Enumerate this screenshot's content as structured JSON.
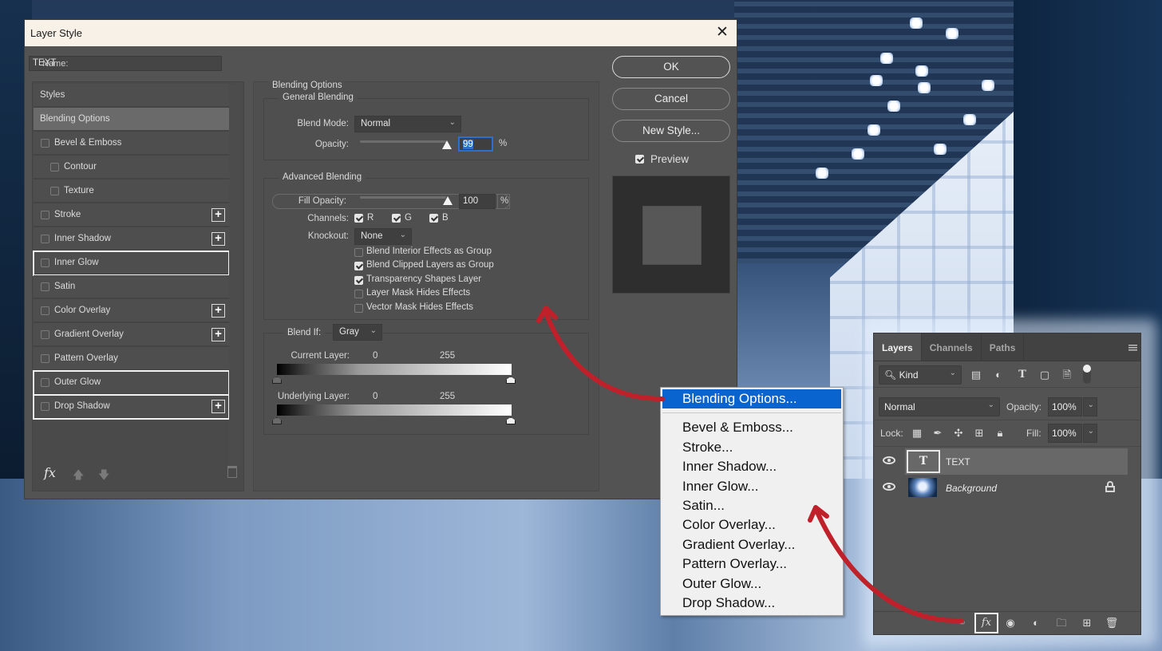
{
  "dialog": {
    "title": "Layer Style",
    "close_glyph": "✕",
    "name_label": "Name:",
    "name_value": "TEXT",
    "styles_header": "Styles",
    "styles": [
      {
        "label": "Blending Options",
        "active": true,
        "checkbox": false,
        "plus": false,
        "highlighted": false
      },
      {
        "label": "Bevel & Emboss",
        "checked": false,
        "plus": false,
        "highlighted": false
      },
      {
        "label": "Contour",
        "checked": false,
        "sub": true,
        "plus": false,
        "highlighted": false
      },
      {
        "label": "Texture",
        "checked": false,
        "sub": true,
        "plus": false,
        "highlighted": false
      },
      {
        "label": "Stroke",
        "checked": false,
        "plus": true,
        "highlighted": false
      },
      {
        "label": "Inner Shadow",
        "checked": false,
        "plus": true,
        "highlighted": false
      },
      {
        "label": "Inner Glow",
        "checked": false,
        "plus": false,
        "highlighted": true
      },
      {
        "label": "Satin",
        "checked": false,
        "plus": false,
        "highlighted": false
      },
      {
        "label": "Color Overlay",
        "checked": false,
        "plus": true,
        "highlighted": false
      },
      {
        "label": "Gradient Overlay",
        "checked": false,
        "plus": true,
        "highlighted": false
      },
      {
        "label": "Pattern Overlay",
        "checked": false,
        "plus": false,
        "highlighted": false
      },
      {
        "label": "Outer Glow",
        "checked": false,
        "plus": false,
        "highlighted": true
      },
      {
        "label": "Drop Shadow",
        "checked": false,
        "plus": true,
        "highlighted": true
      }
    ],
    "footer": {
      "fx_label": "fx",
      "move_up_glyph": "🡅",
      "move_down_glyph": "🡇"
    },
    "blending_options": {
      "title": "Blending Options",
      "general": {
        "title": "General Blending",
        "blend_mode_label": "Blend Mode:",
        "blend_mode_value": "Normal",
        "opacity_label": "Opacity:",
        "opacity_value": "99",
        "opacity_unit": "%"
      },
      "advanced": {
        "title": "Advanced Blending",
        "fill_opacity_label": "Fill Opacity:",
        "fill_opacity_value": "100",
        "fill_opacity_unit": "%",
        "channels_label": "Channels:",
        "channels": [
          {
            "label": "R",
            "checked": true
          },
          {
            "label": "G",
            "checked": true
          },
          {
            "label": "B",
            "checked": true
          }
        ],
        "knockout_label": "Knockout:",
        "knockout_value": "None",
        "options": [
          {
            "label": "Blend Interior Effects as Group",
            "checked": false
          },
          {
            "label": "Blend Clipped Layers as Group",
            "checked": true
          },
          {
            "label": "Transparency Shapes Layer",
            "checked": true
          },
          {
            "label": "Layer Mask Hides Effects",
            "checked": false
          },
          {
            "label": "Vector Mask Hides Effects",
            "checked": false
          }
        ]
      },
      "blend_if": {
        "label": "Blend If:",
        "value": "Gray",
        "current_layer_label": "Current Layer:",
        "current_low": "0",
        "current_high": "255",
        "underlying_layer_label": "Underlying Layer:",
        "underlying_low": "0",
        "underlying_high": "255"
      }
    },
    "buttons": {
      "ok": "OK",
      "cancel": "Cancel",
      "new_style": "New Style..."
    },
    "preview": {
      "label": "Preview",
      "checked": true
    }
  },
  "context_menu": {
    "items": [
      {
        "label": "Blending Options...",
        "selected": true
      },
      {
        "separator": true
      },
      {
        "label": "Bevel & Emboss..."
      },
      {
        "label": "Stroke..."
      },
      {
        "label": "Inner Shadow..."
      },
      {
        "label": "Inner Glow..."
      },
      {
        "label": "Satin..."
      },
      {
        "label": "Color Overlay..."
      },
      {
        "label": "Gradient Overlay..."
      },
      {
        "label": "Pattern Overlay..."
      },
      {
        "label": "Outer Glow..."
      },
      {
        "label": "Drop Shadow..."
      }
    ]
  },
  "layers_panel": {
    "tabs": [
      {
        "label": "Layers",
        "active": true
      },
      {
        "label": "Channels",
        "active": false
      },
      {
        "label": "Paths",
        "active": false
      }
    ],
    "filter_kind": "Kind",
    "blend_mode": "Normal",
    "opacity_label": "Opacity:",
    "opacity_value": "100%",
    "lock_label": "Lock:",
    "fill_label": "Fill:",
    "fill_value": "100%",
    "layers": [
      {
        "name": "TEXT",
        "type": "text",
        "thumb_glyph": "T",
        "visible": true,
        "selected": true,
        "locked": false
      },
      {
        "name": "Background",
        "type": "image",
        "visible": true,
        "selected": false,
        "locked": true
      }
    ]
  },
  "annotations": {
    "arrow_color": "#c0202a"
  },
  "colors": {
    "menu_selected": "#0a64d0",
    "focus_border": "#2d6fcf",
    "dialog_bg": "#535353",
    "titlebar_bg": "#f7f1e8"
  }
}
